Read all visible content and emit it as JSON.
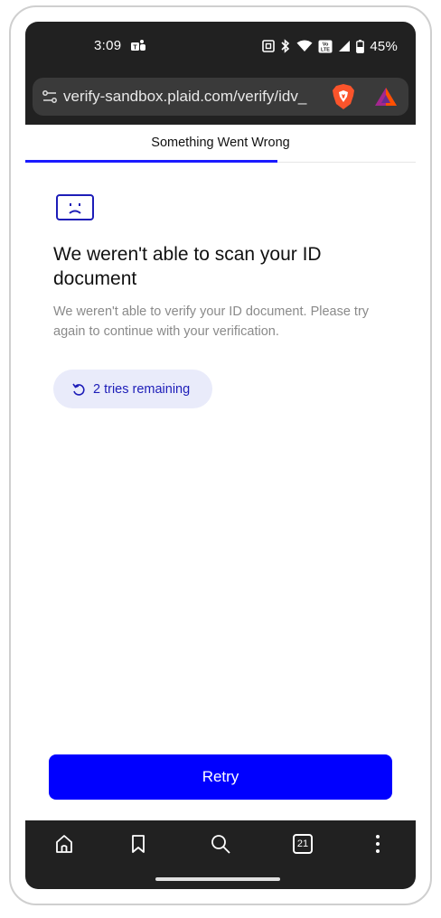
{
  "status_bar": {
    "time": "3:09",
    "battery": "45%",
    "icons": [
      "teams-icon",
      "nfc-icon",
      "bluetooth-icon",
      "wifi-icon",
      "volte-icon",
      "signal-icon",
      "battery-icon"
    ]
  },
  "browser": {
    "url": "verify-sandbox.plaid.com/verify/idv_",
    "icons": [
      "tune-icon",
      "brave-shield-icon",
      "brave-rewards-icon"
    ]
  },
  "page": {
    "header_title": "Something Went Wrong",
    "progress_fraction": 0.645,
    "error_title": "We weren't able to scan your ID document",
    "error_description": "We weren't able to verify your ID document. Please try again to continue with your verification.",
    "tries_label": "2 tries remaining",
    "retry_label": "Retry"
  },
  "bottom_nav": {
    "items": [
      "home-icon",
      "bookmark-icon",
      "search-icon",
      "tabs-icon",
      "menu-icon"
    ],
    "tabs_count": "21"
  },
  "colors": {
    "accent": "#0000ff",
    "browser_chrome": "#212121",
    "pill_background": "#e9ebfa",
    "pill_text": "#1d1db8"
  }
}
